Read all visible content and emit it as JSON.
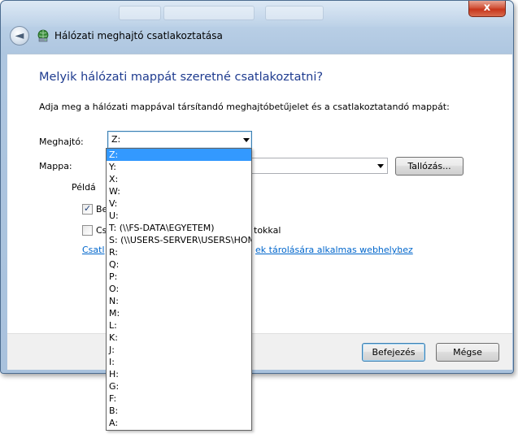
{
  "window": {
    "title": "Hálózati meghajtó csatlakoztatása",
    "close_label": "x",
    "back_label": "◄"
  },
  "main": {
    "heading": "Melyik hálózati mappát szeretné csatlakoztatni?",
    "instruction": "Adja meg a hálózati mappával társítandó meghajtóbetűjelet és a csatlakoztatandó mappát:",
    "drive_label": "Meghajtó:",
    "drive_value": "Z:",
    "folder_label": "Mappa:",
    "folder_value": "",
    "browse_label": "Tallózás...",
    "example_label": "Példá",
    "reconnect_checkbox": {
      "label": "Be",
      "checked": true
    },
    "credentials_checkbox": {
      "label": "Cs",
      "suffix": "tokkal",
      "checked": false
    },
    "link_prefix": "Csatl",
    "link_suffix": "ek tárolására alkalmas webhelyhez",
    "link_period": "."
  },
  "footer": {
    "finish_label": "Befejezés",
    "cancel_label": "Mégse"
  },
  "dropdown": {
    "selected": "Z:",
    "items": [
      "Z:",
      "Y:",
      "X:",
      "W:",
      "V:",
      "U:",
      "T: (\\\\FS-DATA\\EGYETEM)",
      "S: (\\\\USERS-SERVER\\USERS\\HOM",
      "R:",
      "Q:",
      "P:",
      "O:",
      "N:",
      "M:",
      "L:",
      "K:",
      "J:",
      "I:",
      "H:",
      "G:",
      "F:",
      "B:",
      "A:"
    ]
  },
  "icons": {
    "back": "back-arrow-icon",
    "wizard": "network-drive-icon",
    "dropdown_arrow": "chevron-down-icon",
    "close": "close-icon"
  },
  "colors": {
    "heading": "#1e3b8f",
    "link": "#0066cc",
    "selection": "#3399ff",
    "close_button": "#c7361c"
  }
}
